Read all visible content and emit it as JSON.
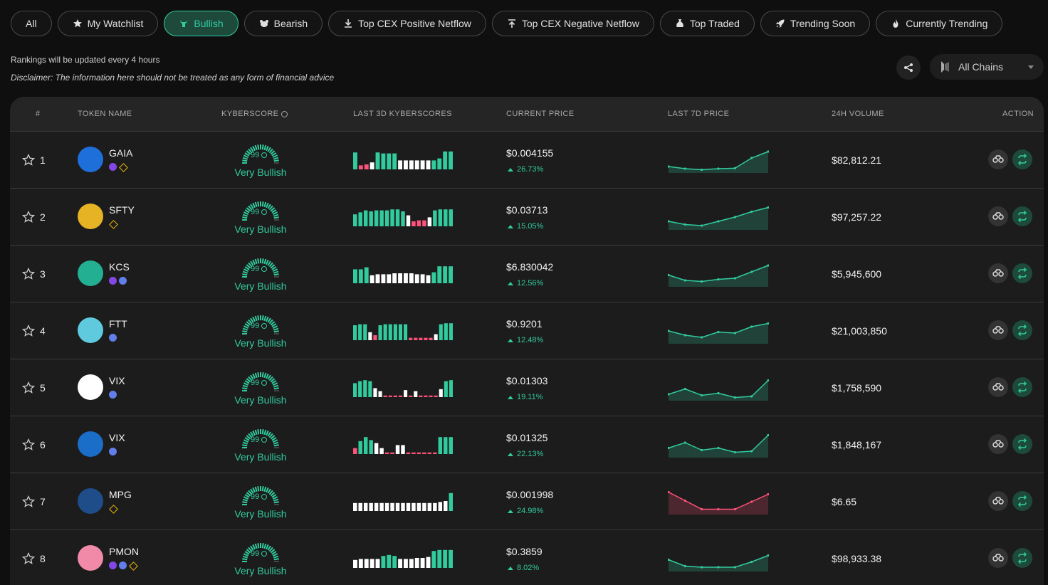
{
  "tabs": [
    {
      "label": "All",
      "icon": "none",
      "active": false
    },
    {
      "label": "My Watchlist",
      "icon": "star-icon",
      "active": false
    },
    {
      "label": "Bullish",
      "icon": "bull-icon",
      "active": true
    },
    {
      "label": "Bearish",
      "icon": "bear-icon",
      "active": false
    },
    {
      "label": "Top CEX Positive Netflow",
      "icon": "download-icon",
      "active": false
    },
    {
      "label": "Top CEX Negative Netflow",
      "icon": "upload-icon",
      "active": false
    },
    {
      "label": "Top Traded",
      "icon": "money-bag-icon",
      "active": false
    },
    {
      "label": "Trending Soon",
      "icon": "rocket-icon",
      "active": false
    },
    {
      "label": "Currently Trending",
      "icon": "flame-icon",
      "active": false
    }
  ],
  "info": {
    "update_note": "Rankings will be updated every 4 hours",
    "disclaimer": "Disclaimer: The information here should not be treated as any form of financial advice"
  },
  "chain_selector": {
    "value": "All Chains"
  },
  "headers": {
    "rank": "#",
    "token_name": "TOKEN NAME",
    "kyberscore": "KYBERSCORE",
    "last_3d": "LAST 3D KYBERSCORES",
    "current_price": "CURRENT PRICE",
    "last_7d": "LAST 7D PRICE",
    "volume": "24H VOLUME",
    "action": "ACTION"
  },
  "colors": {
    "accent": "#31cb9e",
    "bearish": "#ff537b",
    "neutral_bar": "#ffffff"
  },
  "rows": [
    {
      "rank": "1",
      "symbol": "GAIA",
      "chains": [
        "poly",
        "bnb"
      ],
      "score": "99",
      "verdict": "Very Bullish",
      "price": "$0.004155",
      "change": "26.73%",
      "volume": "$82,812.21",
      "logo_color": "#1e6fd9",
      "bars": [
        "g",
        "p",
        "p",
        "w",
        "g",
        "g",
        "g",
        "g",
        "w",
        "w",
        "w",
        "w",
        "w",
        "w",
        "g",
        "g",
        "g",
        "g"
      ],
      "bar_levels": [
        0.85,
        0.2,
        0.25,
        0.35,
        0.85,
        0.8,
        0.8,
        0.8,
        0.45,
        0.45,
        0.45,
        0.45,
        0.45,
        0.45,
        0.45,
        0.55,
        0.9,
        0.9
      ],
      "spark": [
        0.2,
        0.1,
        0.05,
        0.1,
        0.12,
        0.6,
        0.9
      ],
      "spark_trend": "up"
    },
    {
      "rank": "2",
      "symbol": "SFTY",
      "chains": [
        "bnb"
      ],
      "score": "99",
      "verdict": "Very Bullish",
      "price": "$0.03713",
      "change": "15.05%",
      "volume": "$97,257.22",
      "logo_color": "#e6b325",
      "bars": [
        "g",
        "g",
        "g",
        "g",
        "g",
        "g",
        "g",
        "g",
        "g",
        "g",
        "w",
        "p",
        "p",
        "p",
        "w",
        "g",
        "g",
        "g",
        "g"
      ],
      "bar_levels": [
        0.6,
        0.7,
        0.8,
        0.75,
        0.8,
        0.8,
        0.8,
        0.85,
        0.85,
        0.75,
        0.55,
        0.25,
        0.3,
        0.3,
        0.45,
        0.8,
        0.85,
        0.85,
        0.85
      ],
      "spark": [
        0.3,
        0.15,
        0.1,
        0.3,
        0.5,
        0.75,
        0.95
      ],
      "spark_trend": "up"
    },
    {
      "rank": "3",
      "symbol": "KCS",
      "chains": [
        "poly",
        "eth"
      ],
      "score": "99",
      "verdict": "Very Bullish",
      "price": "$6.830042",
      "change": "12.56%",
      "volume": "$5,945,600",
      "logo_color": "#23af91",
      "bars": [
        "g",
        "g",
        "g",
        "w",
        "w",
        "w",
        "w",
        "w",
        "w",
        "w",
        "w",
        "w",
        "w",
        "w",
        "g",
        "g",
        "g",
        "g"
      ],
      "bar_levels": [
        0.7,
        0.7,
        0.8,
        0.4,
        0.45,
        0.45,
        0.45,
        0.5,
        0.5,
        0.5,
        0.5,
        0.45,
        0.45,
        0.4,
        0.55,
        0.85,
        0.85,
        0.85
      ],
      "spark": [
        0.45,
        0.2,
        0.15,
        0.25,
        0.3,
        0.6,
        0.9
      ],
      "spark_trend": "up"
    },
    {
      "rank": "4",
      "symbol": "FTT",
      "chains": [
        "eth"
      ],
      "score": "99",
      "verdict": "Very Bullish",
      "price": "$0.9201",
      "change": "12.48%",
      "volume": "$21,003,850",
      "logo_color": "#5fcade",
      "bars": [
        "g",
        "g",
        "g",
        "w",
        "p",
        "g",
        "g",
        "g",
        "g",
        "g",
        "g",
        "p",
        "p",
        "p",
        "p",
        "p",
        "w",
        "g",
        "g",
        "g"
      ],
      "bar_levels": [
        0.75,
        0.8,
        0.8,
        0.4,
        0.25,
        0.75,
        0.8,
        0.8,
        0.8,
        0.8,
        0.8,
        0.12,
        0.12,
        0.12,
        0.12,
        0.12,
        0.3,
        0.8,
        0.85,
        0.85
      ],
      "spark": [
        0.5,
        0.3,
        0.2,
        0.45,
        0.4,
        0.7,
        0.85
      ],
      "spark_trend": "up"
    },
    {
      "rank": "5",
      "symbol": "VIX",
      "chains": [
        "eth"
      ],
      "score": "99",
      "verdict": "Very Bullish",
      "price": "$0.01303",
      "change": "19.11%",
      "volume": "$1,758,590",
      "logo_color": "#ffffff",
      "bars": [
        "g",
        "g",
        "g",
        "g",
        "w",
        "w",
        "p",
        "p",
        "p",
        "p",
        "w",
        "p",
        "w",
        "p",
        "p",
        "p",
        "p",
        "w",
        "g",
        "g"
      ],
      "bar_levels": [
        0.7,
        0.8,
        0.85,
        0.8,
        0.45,
        0.3,
        0.08,
        0.08,
        0.08,
        0.08,
        0.35,
        0.08,
        0.3,
        0.08,
        0.08,
        0.08,
        0.08,
        0.4,
        0.8,
        0.85
      ],
      "spark": [
        0.2,
        0.45,
        0.15,
        0.25,
        0.05,
        0.1,
        0.85
      ],
      "spark_trend": "up"
    },
    {
      "rank": "6",
      "symbol": "VIX",
      "chains": [
        "eth"
      ],
      "score": "99",
      "verdict": "Very Bullish",
      "price": "$0.01325",
      "change": "22.13%",
      "volume": "$1,848,167",
      "logo_color": "#1a6ec7",
      "bars": [
        "p",
        "g",
        "g",
        "g",
        "w",
        "w",
        "p",
        "p",
        "w",
        "w",
        "p",
        "p",
        "p",
        "p",
        "p",
        "p",
        "g",
        "g",
        "g"
      ],
      "bar_levels": [
        0.3,
        0.65,
        0.85,
        0.7,
        0.55,
        0.3,
        0.08,
        0.08,
        0.45,
        0.45,
        0.08,
        0.08,
        0.08,
        0.08,
        0.08,
        0.08,
        0.85,
        0.85,
        0.85
      ],
      "spark": [
        0.35,
        0.6,
        0.25,
        0.35,
        0.15,
        0.2,
        0.95
      ],
      "spark_trend": "up"
    },
    {
      "rank": "7",
      "symbol": "MPG",
      "chains": [
        "bnb"
      ],
      "score": "99",
      "verdict": "Very Bullish",
      "price": "$0.001998",
      "change": "24.98%",
      "volume": "$6.65",
      "logo_color": "#1f4d8a",
      "bars": [
        "w",
        "w",
        "w",
        "w",
        "w",
        "w",
        "w",
        "w",
        "w",
        "w",
        "w",
        "w",
        "w",
        "w",
        "w",
        "w",
        "w",
        "w",
        "g"
      ],
      "bar_levels": [
        0.4,
        0.4,
        0.4,
        0.4,
        0.4,
        0.4,
        0.4,
        0.4,
        0.4,
        0.4,
        0.4,
        0.4,
        0.4,
        0.4,
        0.4,
        0.4,
        0.45,
        0.5,
        0.9
      ],
      "spark": [
        0.95,
        0.55,
        0.15,
        0.15,
        0.15,
        0.5,
        0.85
      ],
      "spark_trend": "down"
    },
    {
      "rank": "8",
      "symbol": "PMON",
      "chains": [
        "poly",
        "eth",
        "bnb"
      ],
      "score": "99",
      "verdict": "Very Bullish",
      "price": "$0.3859",
      "change": "8.02%",
      "volume": "$98,933.38",
      "logo_color": "#f08aa8",
      "bars": [
        "w",
        "w",
        "w",
        "w",
        "w",
        "g",
        "g",
        "g",
        "w",
        "w",
        "w",
        "w",
        "w",
        "w",
        "g",
        "g",
        "g",
        "g"
      ],
      "bar_levels": [
        0.4,
        0.45,
        0.45,
        0.45,
        0.45,
        0.6,
        0.65,
        0.6,
        0.45,
        0.45,
        0.45,
        0.5,
        0.5,
        0.55,
        0.85,
        0.9,
        0.9,
        0.9
      ],
      "spark": [
        0.45,
        0.15,
        0.1,
        0.1,
        0.1,
        0.35,
        0.65
      ],
      "spark_trend": "up"
    }
  ]
}
